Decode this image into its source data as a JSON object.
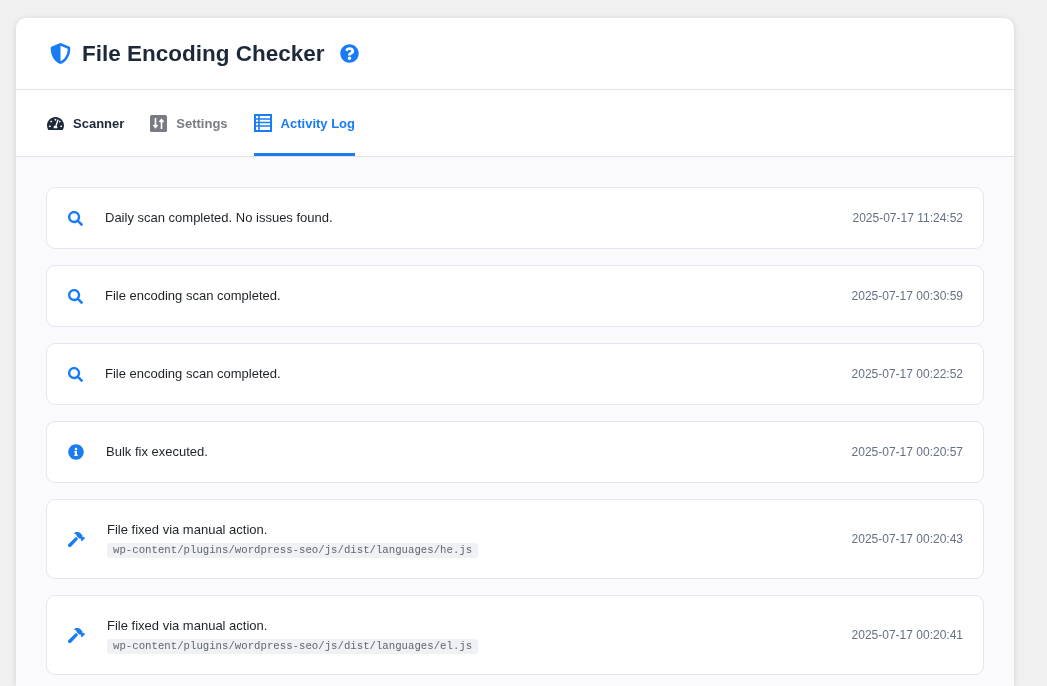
{
  "header": {
    "title": "File Encoding Checker"
  },
  "tabs": [
    {
      "label": "Scanner",
      "selected": false,
      "hovered": true
    },
    {
      "label": "Settings",
      "selected": false,
      "hovered": false
    },
    {
      "label": "Activity Log",
      "selected": true,
      "hovered": false
    }
  ],
  "log_entries": [
    {
      "kind": "scan",
      "message": "Daily scan completed. No issues found.",
      "timestamp": "2025-07-17 11:24:52"
    },
    {
      "kind": "scan",
      "message": "File encoding scan completed.",
      "timestamp": "2025-07-17 00:30:59"
    },
    {
      "kind": "scan",
      "message": "File encoding scan completed.",
      "timestamp": "2025-07-17 00:22:52"
    },
    {
      "kind": "info",
      "message": "Bulk fix executed.",
      "timestamp": "2025-07-17 00:20:57"
    },
    {
      "kind": "fix",
      "message": "File fixed via manual action.",
      "path": "wp-content/plugins/wordpress-seo/js/dist/languages/he.js",
      "timestamp": "2025-07-17 00:20:43"
    },
    {
      "kind": "fix",
      "message": "File fixed via manual action.",
      "path": "wp-content/plugins/wordpress-seo/js/dist/languages/el.js",
      "timestamp": "2025-07-17 00:20:41"
    }
  ]
}
